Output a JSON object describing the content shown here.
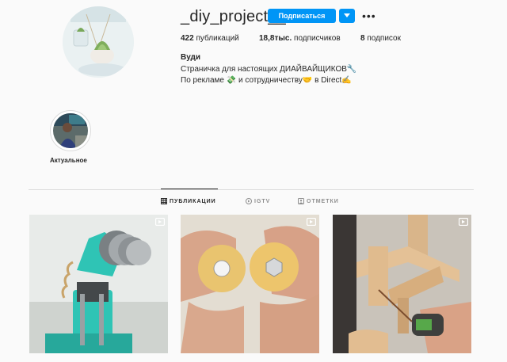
{
  "profile": {
    "username": "_diy_project__",
    "follow_label": "Подписаться",
    "name": "Вуди",
    "bio": [
      "Страничка для настоящих ДИАЙВАЙЩИКОВ🔧",
      "По рекламе 💸 и сотрудничеству🤝 в Direct✍"
    ]
  },
  "stats": [
    {
      "value": "422",
      "label": " публикаций"
    },
    {
      "value": "18,8тыс.",
      "label": " подписчиков"
    },
    {
      "value": "8",
      "label": " подписок"
    }
  ],
  "highlight": {
    "label": "Актуальное"
  },
  "tabs": [
    {
      "label": "ПУБЛИКАЦИИ",
      "icon": "grid-icon"
    },
    {
      "label": "IGTV",
      "icon": "igtv-icon"
    },
    {
      "label": "ОТМЕТКИ",
      "icon": "tag-icon"
    }
  ],
  "posts": [
    {
      "icon": "video-icon"
    },
    {
      "icon": "video-icon"
    },
    {
      "icon": "video-icon"
    }
  ]
}
